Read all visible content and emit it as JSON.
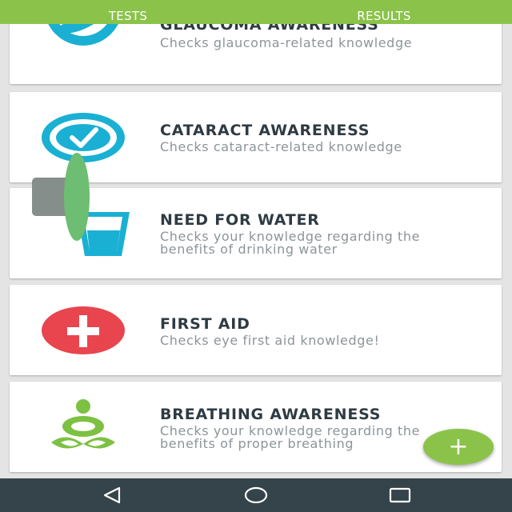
{
  "tabs": [
    {
      "label": "TESTS"
    },
    {
      "label": "RESULTS"
    }
  ],
  "cards": [
    {
      "title": "GLAUCOMA AWARENESS",
      "desc": "Checks glaucoma-related knowledge",
      "icon": "glaucoma-icon",
      "color": "#1ab0d3"
    },
    {
      "title": "CATARACT AWARENESS",
      "desc": "Checks cataract-related knowledge",
      "icon": "cataract-check-icon",
      "color": "#1ab0d3"
    },
    {
      "title": "NEED FOR WATER",
      "desc": "Checks your knowledge regarding the benefits of drinking water",
      "icon": "water-glass-icon",
      "color": "#1ab0d3"
    },
    {
      "title": "FIRST AID",
      "desc": "Checks eye first aid knowledge!",
      "icon": "first-aid-cross-icon",
      "color": "#e8454e"
    },
    {
      "title": "BREATHING AWARENESS",
      "desc": "Checks your knowledge regarding the benefits of proper breathing",
      "icon": "meditation-icon",
      "color": "#7cc142"
    }
  ],
  "fab": {
    "label": "+",
    "icon": "plus-icon"
  },
  "navbar": {
    "icons": [
      "back-triangle-icon",
      "home-circle-icon",
      "recents-square-icon"
    ]
  },
  "colors": {
    "accent": "#8bc34a",
    "navbar": "#34444a",
    "icon_blue": "#1ab0d3",
    "icon_red": "#e8454e",
    "icon_green": "#7cc142"
  }
}
